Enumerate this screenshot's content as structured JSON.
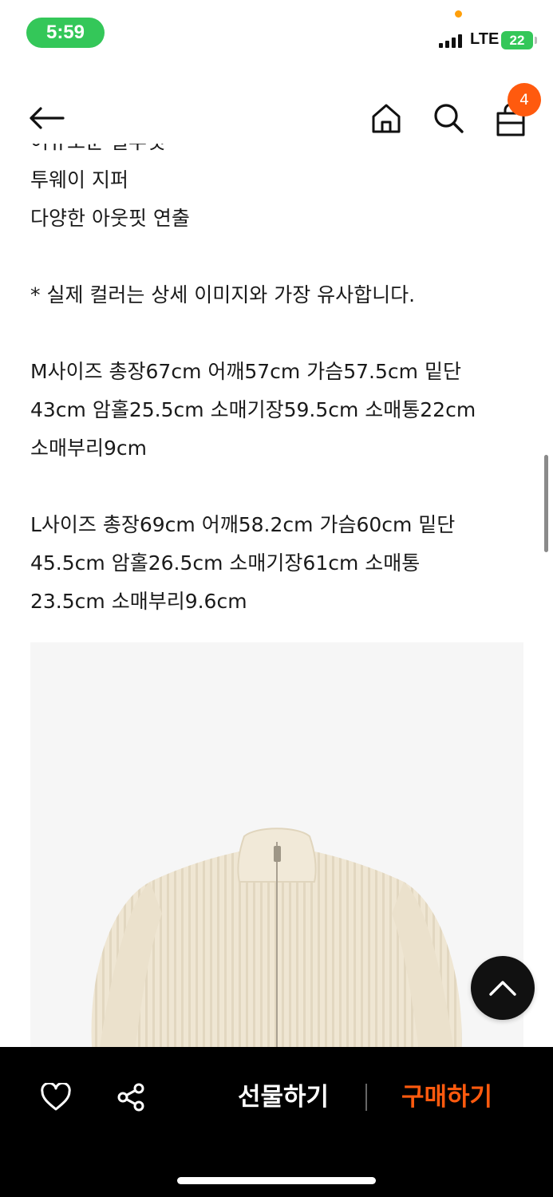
{
  "status_bar": {
    "time": "5:59",
    "network": "LTE",
    "battery": "22"
  },
  "nav": {
    "cart_count": "4"
  },
  "description": {
    "clipped_line": "어유노운 실루엣",
    "lines_top": [
      "투웨이 지퍼",
      "다양한 아웃핏 연출"
    ],
    "color_note": "* 실제 컬러는 상세 이미지와 가장 유사합니다.",
    "size_m": [
      "M사이즈 총장67cm 어깨57cm 가슴57.5cm 밑단",
      "43cm 암홀25.5cm 소매기장59.5cm 소매통22cm",
      "소매부리9cm"
    ],
    "size_l": [
      "L사이즈 총장69cm 어깨58.2cm 가슴60cm 밑단",
      "45.5cm 암홀26.5cm 소매기장61cm 소매통",
      "23.5cm 소매부리9.6cm"
    ]
  },
  "bottom_bar": {
    "gift_label": "선물하기",
    "buy_label": "구매하기"
  },
  "colors": {
    "accent": "#ff5a0e",
    "status_green": "#34c759"
  }
}
